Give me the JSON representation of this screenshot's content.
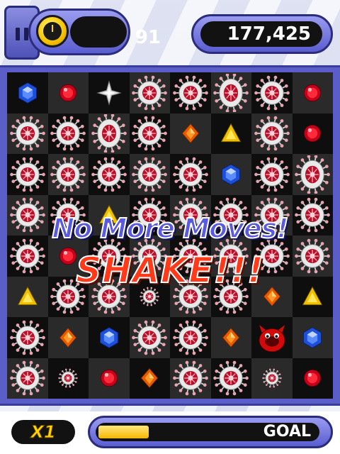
{
  "hud": {
    "timer_value": "91",
    "score_value": "177,425",
    "multiplier": "X1",
    "goal_label": "GOAL",
    "goal_progress": 0.31
  },
  "overlay": {
    "line1": "No More Moves!",
    "line2": "SHAKE!!!"
  },
  "board": {
    "rows": 8,
    "cols": 8,
    "cells": [
      [
        "blue-gem",
        "red-gem",
        "silver-star",
        "virus",
        "virus",
        "virus-big",
        "virus",
        "red-gem"
      ],
      [
        "virus",
        "virus",
        "virus-big",
        "virus",
        "orange-gem",
        "yellow-gem",
        "virus",
        "red-gem"
      ],
      [
        "virus",
        "virus",
        "virus",
        "virus",
        "virus",
        "blue-gem",
        "virus",
        "virus-big"
      ],
      [
        "virus",
        "virus",
        "yellow-gem",
        "virus",
        "virus",
        "virus",
        "virus",
        "virus"
      ],
      [
        "virus",
        "red-gem",
        "virus",
        "virus",
        "virus",
        "virus",
        "virus",
        "virus"
      ],
      [
        "yellow-gem",
        "virus",
        "virus",
        "virus-small",
        "virus",
        "virus",
        "orange-gem",
        "yellow-gem"
      ],
      [
        "virus",
        "orange-gem",
        "blue-gem",
        "virus",
        "virus",
        "orange-gem",
        "red-monster",
        "blue-gem"
      ],
      [
        "virus",
        "virus-small",
        "red-gem",
        "orange-gem",
        "virus",
        "virus",
        "virus-small",
        "red-gem"
      ]
    ]
  },
  "icons": {
    "pause": "pause-icon",
    "timer": "stopwatch-icon"
  }
}
